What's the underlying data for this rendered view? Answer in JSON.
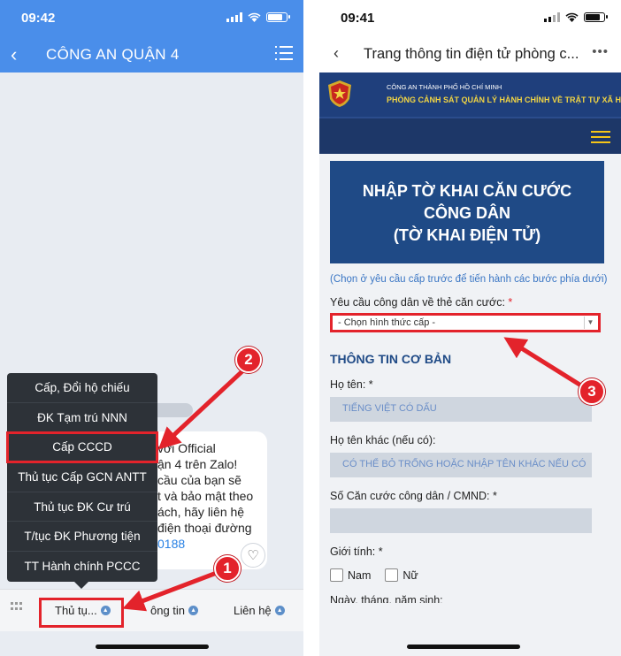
{
  "left_phone": {
    "status_time": "09:42",
    "header": {
      "title": "CÔNG AN QUẬN 4"
    },
    "message_lines": [
      "với Official",
      "ận 4 trên Zalo!",
      "cầu của bạn sẽ",
      "t và bảo mật theo",
      "ách, hãy liên hệ",
      "điện thoại đường"
    ],
    "message_link": "0188",
    "menu_items": [
      "Cấp, Đổi hộ chiếu",
      "ĐK Tạm trú NNN",
      "Cấp CCCD",
      "Thủ tục Cấp GCN ANTT",
      "Thủ tục ĐK Cư trú",
      "T/tục ĐK Phương tiện",
      "TT Hành chính PCCC"
    ],
    "bottom_bar": {
      "procedures": "Thủ tụ...",
      "info": "ông tin",
      "contact": "Liên hệ"
    }
  },
  "right_phone": {
    "status_time": "09:41",
    "header": {
      "title": "Trang thông tin điện tử phòng c..."
    },
    "banner": {
      "line1": "CÔNG AN THÀNH PHỐ HỒ CHÍ MINH",
      "line2": "PHÒNG CẢNH SÁT QUẢN LÝ HÀNH CHÍNH VỀ TRẬT TỰ XÃ HỘI"
    },
    "hero": [
      "NHẬP TỜ KHAI CĂN CƯỚC",
      "CÔNG DÂN",
      "(TỜ KHAI ĐIỆN TỬ)"
    ],
    "hint": "(Chọn ở yêu cầu cấp trước để tiến hành các bước phía dưới)",
    "request_label": "Yêu cầu công dân về thẻ căn cước:",
    "required_mark": "*",
    "select_value": "- Chọn hình thức cấp -",
    "section_title": "THÔNG TIN CƠ BẢN",
    "fields": {
      "name_label": "Họ tên:",
      "name_placeholder": "TIẾNG VIỆT CÓ DẤU",
      "other_name_label": "Họ tên khác (nếu có):",
      "other_name_placeholder": "CÓ THỂ BỎ TRỐNG HOẶC NHẬP TÊN KHÁC NẾU CÓ",
      "id_label": "Số Căn cước công dân / CMND:",
      "gender_label": "Giới tính:",
      "male": "Nam",
      "female": "Nữ",
      "dob_label_partial": "Ngày, tháng, năm sinh:"
    }
  },
  "annotations": {
    "step1": "1",
    "step2": "2",
    "step3": "3"
  },
  "colors": {
    "zalo_blue": "#4a8eea",
    "highlight_red": "#e3232b",
    "navy": "#1f4a86"
  }
}
